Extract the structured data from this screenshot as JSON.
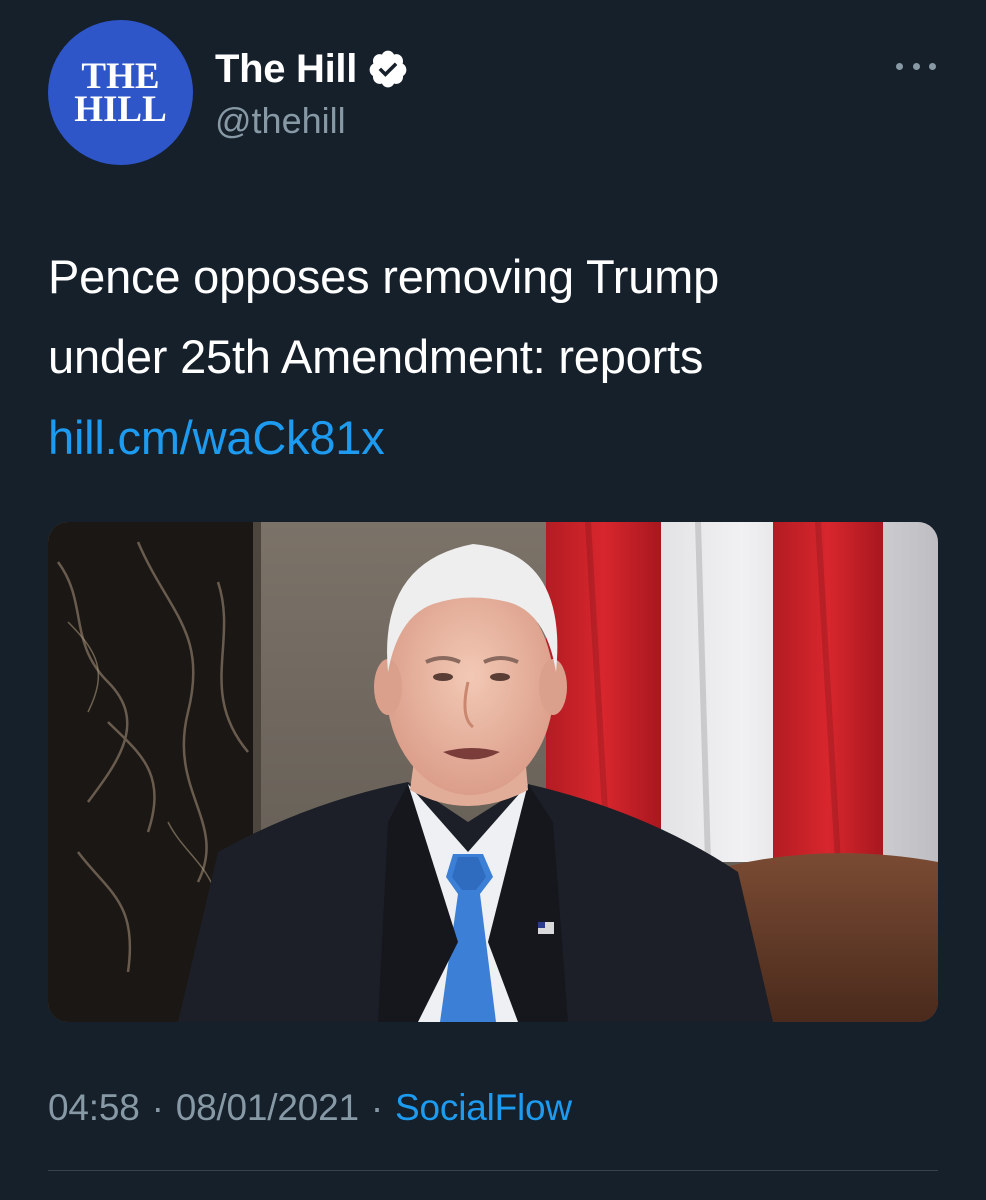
{
  "tweet": {
    "avatar": {
      "logo_line1": "THE",
      "logo_line2": "HILL",
      "color": "#2e56c8"
    },
    "author": {
      "display_name": "The Hill",
      "handle": "@thehill",
      "verified": true,
      "verified_icon": "verified-badge-icon"
    },
    "more_icon": "more-options-icon",
    "text_line1": "Pence opposes removing Trump",
    "text_line2": "under 25th Amendment: reports",
    "link_text": "hill.cm/waCk81x",
    "media": {
      "type": "photo"
    },
    "time": "04:58",
    "date": "08/01/2021",
    "separator": "·",
    "source": "SocialFlow"
  },
  "colors": {
    "background": "#15202b",
    "text_primary": "#ffffff",
    "text_secondary": "#8899a6",
    "accent": "#1d9bf0",
    "divider": "#38444d"
  }
}
